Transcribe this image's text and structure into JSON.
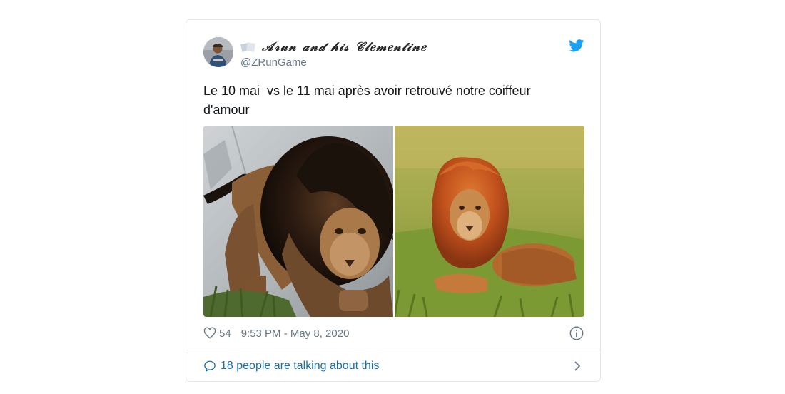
{
  "tweet": {
    "display_name": "𝒜𝓇𝓊𝓃 𝒶𝓃𝒹 𝒽𝒾𝓈 𝒞𝓁𝑒𝓂𝑒𝓃𝓉𝒾𝓃𝑒",
    "handle": "@ZRunGame",
    "text": "Le 10 mai  vs le 11 mai après avoir retrouvé notre coiffeur d'amour",
    "likes": "54",
    "timestamp": "9:53 PM - May 8, 2020",
    "conversation_label": "18 people are talking about this"
  },
  "colors": {
    "twitter_blue": "#1da1f2",
    "link_blue": "#1b6fa8",
    "muted_gray": "#657786",
    "border": "#e1e8ed"
  },
  "icons": {
    "brand": "twitter-bird-icon",
    "like": "heart-outline-icon",
    "info": "info-circle-icon",
    "reply": "speech-bubble-icon",
    "open": "chevron-right-icon"
  }
}
